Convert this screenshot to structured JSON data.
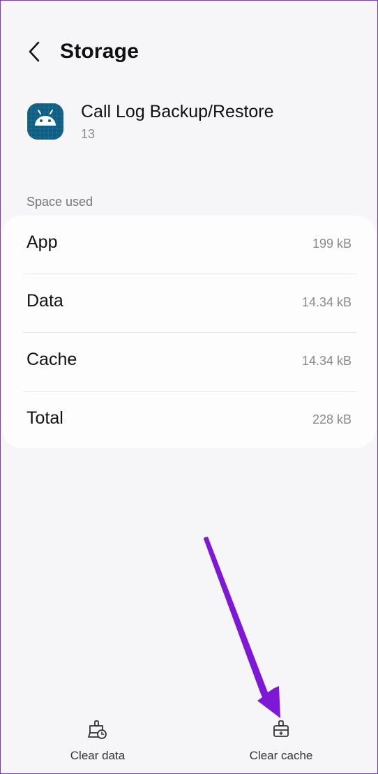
{
  "header": {
    "back_icon": "back-arrow-icon",
    "title": "Storage"
  },
  "app": {
    "icon": "android-icon",
    "name": "Call Log Backup/Restore",
    "version": "13"
  },
  "space_used": {
    "label": "Space used",
    "rows": [
      {
        "label": "App",
        "value": "199 kB"
      },
      {
        "label": "Data",
        "value": "14.34 kB"
      },
      {
        "label": "Cache",
        "value": "14.34 kB"
      },
      {
        "label": "Total",
        "value": "228 kB"
      }
    ]
  },
  "actions": {
    "clear_data": {
      "label": "Clear data",
      "icon": "clear-data-icon"
    },
    "clear_cache": {
      "label": "Clear cache",
      "icon": "clear-cache-icon"
    }
  },
  "colors": {
    "background": "#f6f5f7",
    "card": "#fdfdfd",
    "app_icon": "#0f5f84",
    "annotation_arrow": "#7e17d6",
    "frame_border": "#7a3fb0"
  }
}
